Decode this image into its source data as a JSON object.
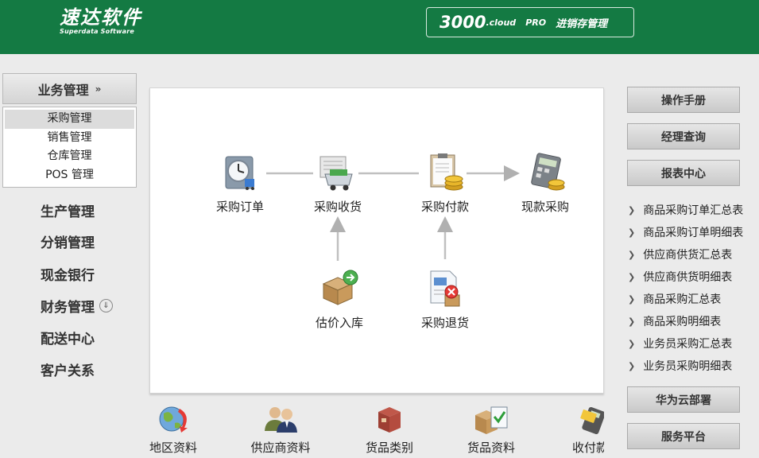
{
  "header": {
    "logo_cn": "速达软件",
    "logo_en": "Superdata Software",
    "product_num": "3000",
    "product_cloud": ".cloud",
    "product_pro": "PRO",
    "product_name": "进销存管理",
    "bg_color": "#147a43"
  },
  "sidebar": {
    "category": "业务管理",
    "category_icon": "double-chevron-down-icon",
    "submenu": [
      {
        "label": "采购管理",
        "active": true
      },
      {
        "label": "销售管理",
        "active": false
      },
      {
        "label": "仓库管理",
        "active": false
      },
      {
        "label": "POS 管理",
        "active": false
      }
    ],
    "nav": [
      {
        "label": "生产管理"
      },
      {
        "label": "分销管理"
      },
      {
        "label": "现金银行"
      },
      {
        "label": "财务管理",
        "icon": "circle-chevron-down-icon"
      },
      {
        "label": "配送中心"
      },
      {
        "label": "客户关系"
      }
    ]
  },
  "workflow": {
    "nodes": [
      {
        "label": "采购订单",
        "icon": "purchase-order-icon"
      },
      {
        "label": "采购收货",
        "icon": "purchase-receipt-icon"
      },
      {
        "label": "采购付款",
        "icon": "purchase-payment-icon"
      },
      {
        "label": "现款采购",
        "icon": "cash-purchase-icon"
      },
      {
        "label": "估价入库",
        "icon": "estimated-stock-in-icon"
      },
      {
        "label": "采购退货",
        "icon": "purchase-return-icon"
      }
    ]
  },
  "quick_links": [
    {
      "label": "地区资料",
      "icon": "globe-icon"
    },
    {
      "label": "供应商资料",
      "icon": "supplier-people-icon"
    },
    {
      "label": "货品类别",
      "icon": "box-category-icon"
    },
    {
      "label": "货品资料",
      "icon": "goods-info-icon"
    },
    {
      "label": "收付款",
      "icon": "card-terminal-icon"
    }
  ],
  "right": {
    "manual": "操作手册",
    "manager_query": "经理查询",
    "report_center": "报表中心",
    "reports": [
      "商品采购订单汇总表",
      "商品采购订单明细表",
      "供应商供货汇总表",
      "供应商供货明细表",
      "商品采购汇总表",
      "商品采购明细表",
      "业务员采购汇总表",
      "业务员采购明细表"
    ],
    "huawei_cloud": "华为云部署",
    "service_platform": "服务平台"
  }
}
